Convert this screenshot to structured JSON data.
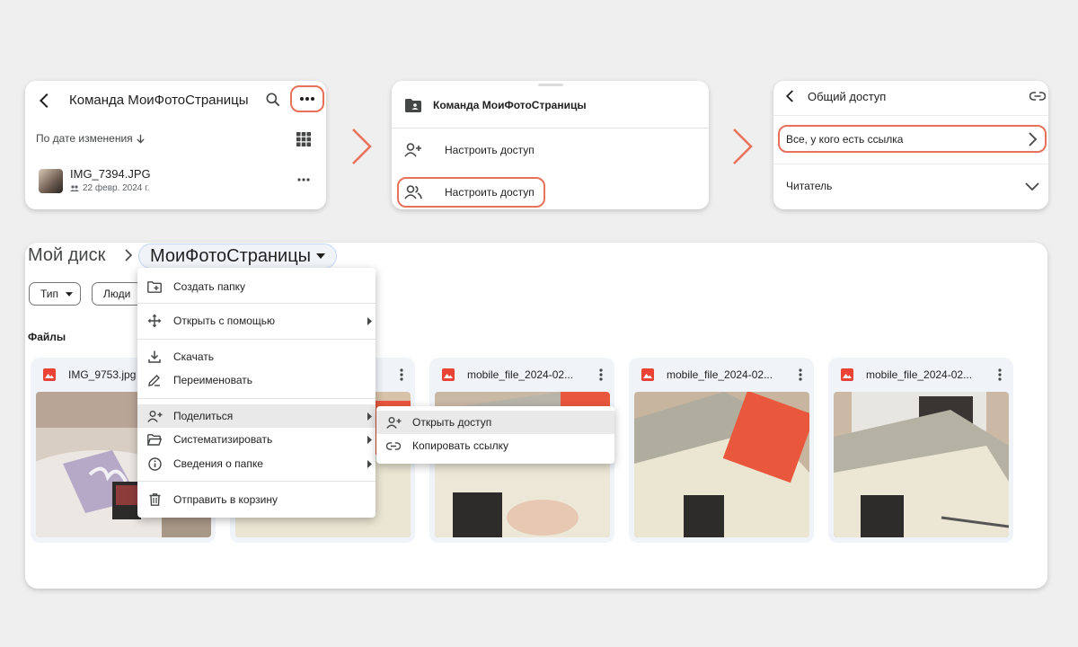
{
  "colors": {
    "highlight": "#e8715a",
    "chip_bg": "#f0f4f9",
    "image_icon": "#ea4335"
  },
  "card1": {
    "title": "Команда МоиФотоСтраницы",
    "sort_label": "По дате изменения",
    "file": {
      "name": "IMG_7394.JPG",
      "date": "22 февр. 2024 г."
    },
    "icons": [
      "arrow-left-icon",
      "search-icon",
      "more-horizontal-icon",
      "grid-view-icon",
      "shared-icon"
    ]
  },
  "card2": {
    "header": "Команда МоиФотоСтраницы",
    "items": [
      {
        "label": "Настроить доступ",
        "icon": "person-add-icon"
      },
      {
        "label": "Настроить доступ",
        "icon": "people-icon"
      }
    ]
  },
  "card3": {
    "title": "Общий доступ",
    "access_option": "Все, у кого есть ссылка",
    "role": "Читатель",
    "icons": [
      "arrow-left-icon",
      "link-icon",
      "chevron-right-icon",
      "chevron-down-icon"
    ]
  },
  "drive": {
    "breadcrumb_root": "Мой диск",
    "breadcrumb_current": "МоиФотоСтраницы",
    "filters": [
      "Тип",
      "Люди"
    ],
    "section_title": "Файлы",
    "files": [
      {
        "name": "IMG_9753.jpg"
      },
      {
        "name": ""
      },
      {
        "name": "mobile_file_2024-02..."
      },
      {
        "name": "mobile_file_2024-02..."
      },
      {
        "name": "mobile_file_2024-02..."
      }
    ]
  },
  "context_menu": {
    "items": [
      {
        "label": "Создать папку",
        "icon": "new-folder-icon"
      },
      {
        "label": "Открыть с помощью",
        "icon": "open-with-icon"
      },
      {
        "label": "Скачать",
        "icon": "download-icon"
      },
      {
        "label": "Переименовать",
        "icon": "rename-icon"
      },
      {
        "label": "Поделиться",
        "icon": "person-add-icon"
      },
      {
        "label": "Систематизировать",
        "icon": "folder-open-icon"
      },
      {
        "label": "Сведения о папке",
        "icon": "info-icon"
      },
      {
        "label": "Отправить в корзину",
        "icon": "trash-icon"
      }
    ]
  },
  "share_submenu": {
    "items": [
      {
        "label": "Открыть доступ",
        "icon": "person-add-icon"
      },
      {
        "label": "Копировать ссылку",
        "icon": "link-icon"
      }
    ]
  }
}
